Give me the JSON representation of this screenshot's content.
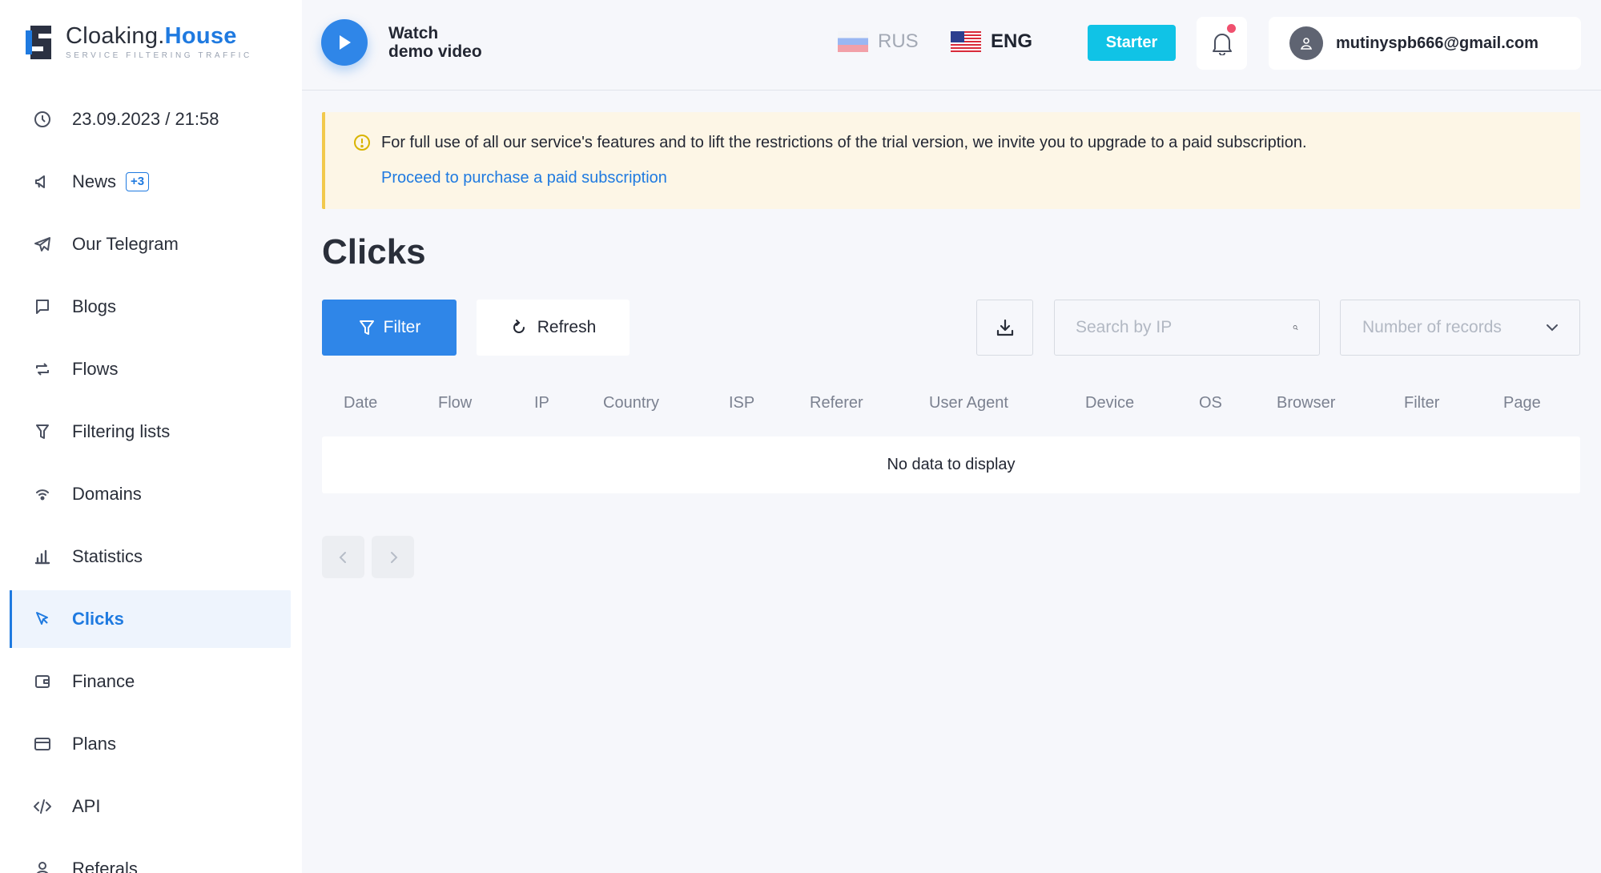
{
  "logo": {
    "title_main": "Cloaking.",
    "title_accent": "House",
    "tagline": "SERVICE FILTERING TRAFFIC"
  },
  "sidebar": {
    "items": [
      {
        "label": "23.09.2023 / 21:58",
        "icon": "clock-icon"
      },
      {
        "label": "News",
        "icon": "megaphone-icon",
        "badge": "+3"
      },
      {
        "label": "Our Telegram",
        "icon": "telegram-icon"
      },
      {
        "label": "Blogs",
        "icon": "message-icon"
      },
      {
        "label": "Flows",
        "icon": "repeat-icon"
      },
      {
        "label": "Filtering lists",
        "icon": "funnel-icon"
      },
      {
        "label": "Domains",
        "icon": "wifi-icon"
      },
      {
        "label": "Statistics",
        "icon": "bar-chart-icon"
      },
      {
        "label": "Clicks",
        "icon": "cursor-icon",
        "active": true
      },
      {
        "label": "Finance",
        "icon": "wallet-icon"
      },
      {
        "label": "Plans",
        "icon": "card-icon"
      },
      {
        "label": "API",
        "icon": "code-icon"
      },
      {
        "label": "Referals",
        "icon": "user-icon"
      }
    ]
  },
  "header": {
    "demo_line1": "Watch",
    "demo_line2": "demo video",
    "lang_rus": "RUS",
    "lang_eng": "ENG",
    "plan": "Starter",
    "user_email": "mutinyspb666@gmail.com"
  },
  "alert": {
    "text": "For full use of all our service's features and to lift the restrictions of the trial version, we invite you to upgrade to a paid subscription.",
    "link": "Proceed to purchase a paid subscription"
  },
  "page": {
    "title": "Clicks"
  },
  "toolbar": {
    "filter_label": "Filter",
    "refresh_label": "Refresh",
    "search_placeholder": "Search by IP",
    "records_placeholder": "Number of records"
  },
  "table": {
    "columns": [
      "Date",
      "Flow",
      "IP",
      "Country",
      "ISP",
      "Referer",
      "User Agent",
      "Device",
      "OS",
      "Browser",
      "Filter",
      "Page"
    ],
    "empty_text": "No data to display"
  },
  "colors": {
    "accent": "#1f7ae0",
    "plan_button": "#10c3e6",
    "alert_border": "#f2c94c",
    "notification_dot": "#f0506e"
  }
}
